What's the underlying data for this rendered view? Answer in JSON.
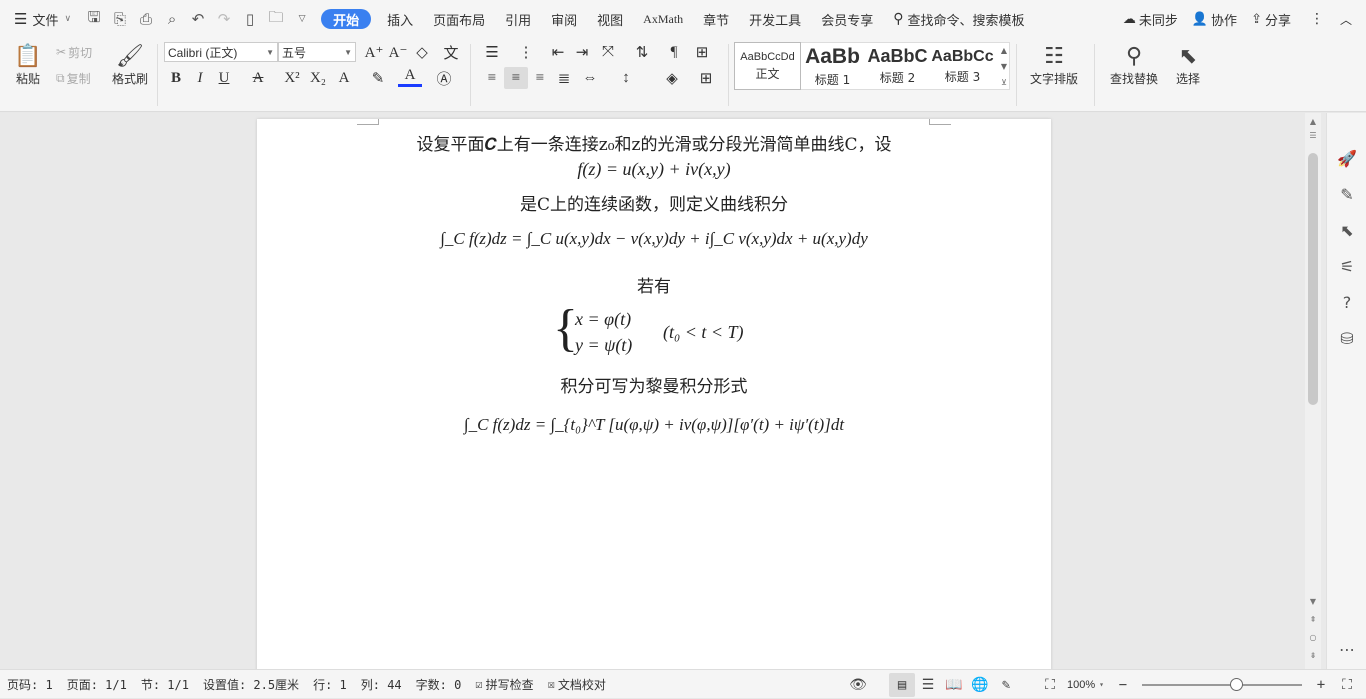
{
  "menubar": {
    "file_label": "文件",
    "tabs": [
      "开始",
      "插入",
      "页面布局",
      "引用",
      "审阅",
      "视图",
      "AxMath",
      "章节",
      "开发工具",
      "会员专享"
    ],
    "search_placeholder": "查找命令、搜索模板",
    "sync_label": "未同步",
    "collab_label": "协作",
    "share_label": "分享"
  },
  "ribbon": {
    "paste": "粘贴",
    "cut": "剪切",
    "copy": "复制",
    "format_painter": "格式刷",
    "font_name": "Calibri (正文)",
    "font_size": "五号",
    "styles": [
      {
        "preview": "AaBbCcDd",
        "label": "正文"
      },
      {
        "preview": "AaBb",
        "label": "标题 1"
      },
      {
        "preview": "AaBbC",
        "label": "标题 2"
      },
      {
        "preview": "AaBbCc",
        "label": "标题 3"
      }
    ],
    "text_layout": "文字排版",
    "find_replace": "查找替换",
    "select": "选择"
  },
  "document": {
    "line1": "设复平面𝑪上有一条连接z₀和z的光滑或分段光滑简单曲线C，设",
    "line2": "f(z) = u(x,y) + iv(x,y)",
    "line3": "是C上的连续函数，则定义曲线积分",
    "line4": "∫_C f(z)dz = ∫_C u(x,y)dx − v(x,y)dy + i∫_C v(x,y)dx + u(x,y)dy",
    "line5": "若有",
    "line6a": "x = φ(t)",
    "line6b": "y = ψ(t)",
    "line6c": "(t₀ < t < T)",
    "line7": "积分可写为黎曼积分形式",
    "line8": "∫_C f(z)dz = ∫_{t₀}^T [u(φ,ψ) + iv(φ,ψ)][φ′(t) + iψ′(t)]dt"
  },
  "statusbar": {
    "page_code": "页码: 1",
    "page": "页面: 1/1",
    "section": "节: 1/1",
    "setting": "设置值: 2.5厘米",
    "row": "行: 1",
    "col": "列: 44",
    "word_count": "字数: 0",
    "spell_check": "拼写检查",
    "doc_proof": "文档校对",
    "zoom": "100%",
    "zoom_value": 0.55
  },
  "colors": {
    "accent": "#3a80f0",
    "font_color_bar": "#1a3cff"
  }
}
